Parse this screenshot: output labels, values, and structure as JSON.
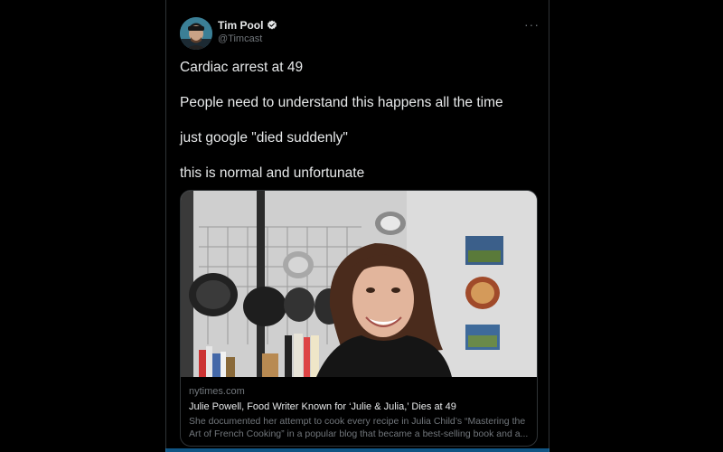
{
  "author": {
    "name": "Tim Pool",
    "handle": "@Timcast"
  },
  "tweet": {
    "lines": [
      "Cardiac arrest at 49",
      "People need to understand this happens all the time",
      "just google \"died suddenly\"",
      "this is normal and unfortunate"
    ]
  },
  "card": {
    "domain": "nytimes.com",
    "title": "Julie Powell, Food Writer Known for ‘Julie & Julia,’ Dies at 49",
    "description_lines": [
      "She documented her attempt to cook every recipe in Julia Child’s “Mastering the",
      "Art of French Cooking” in a popular blog that became a best-selling book and a..."
    ]
  },
  "colors": {
    "background": "#000000",
    "text": "#e7e9ea",
    "muted": "#71767b",
    "accent": "#1d9bf0",
    "border": "#2f3336"
  },
  "icons": {
    "verified": "verified-badge-icon",
    "more": "more-options-icon"
  }
}
